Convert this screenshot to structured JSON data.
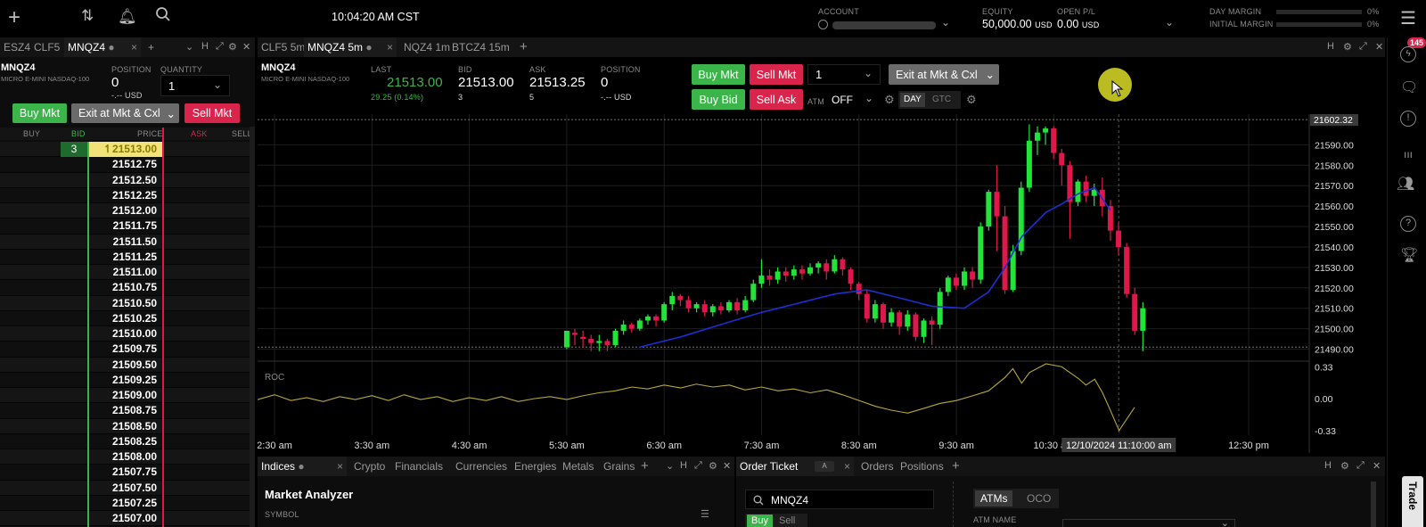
{
  "topbar": {
    "time": "10:04:20 AM CST",
    "account_label": "ACCOUNT",
    "equity_label": "EQUITY",
    "equity_value": "50,000.00",
    "equity_unit": "USD",
    "openpl_label": "OPEN P/L",
    "openpl_value": "0.00",
    "openpl_unit": "USD",
    "day_margin_label": "DAY MARGIN",
    "day_margin_value": "0%",
    "initial_margin_label": "INITIAL MARGIN",
    "initial_margin_value": "0%"
  },
  "left_tabs": [
    "ESZ4",
    "CLF5",
    "MNQZ4"
  ],
  "dom": {
    "symbol": "MNQZ4",
    "description": "MICRO E-MINI NASDAQ-100",
    "position_label": "POSITION",
    "position_value": "0",
    "position_usd": "-.-- USD",
    "quantity_label": "QUANTITY",
    "quantity_value": "1",
    "buy_mkt": "Buy Mkt",
    "exit_mkt": "Exit at Mkt & Cxl",
    "sell_mkt": "Sell Mkt",
    "col_buy": "BUY",
    "col_bid": "BID",
    "col_price": "PRICE",
    "col_ask": "ASK",
    "col_sell": "SELL",
    "bid_size": "3",
    "prices": [
      "21513.00",
      "21512.75",
      "21512.50",
      "21512.25",
      "21512.00",
      "21511.75",
      "21511.50",
      "21511.25",
      "21511.00",
      "21510.75",
      "21510.50",
      "21510.25",
      "21510.00",
      "21509.75",
      "21509.50",
      "21509.25",
      "21509.00",
      "21508.75",
      "21508.50",
      "21508.25",
      "21508.00",
      "21507.75",
      "21507.50",
      "21507.25",
      "21507.00"
    ]
  },
  "chart_tabs": [
    {
      "label": "CLF5",
      "tf": "5m"
    },
    {
      "label": "MNQZ4",
      "tf": "5m"
    },
    {
      "label": "NQZ4",
      "tf": "1m"
    },
    {
      "label": "BTCZ4",
      "tf": "15m"
    }
  ],
  "quote": {
    "symbol": "MNQZ4",
    "description": "MICRO E-MINI NASDAQ-100",
    "last_label": "LAST",
    "last_value": "21513.00",
    "change": "29.25 (0.14%)",
    "bid_label": "BID",
    "bid_value": "21513.00",
    "bid_size": "3",
    "ask_label": "ASK",
    "ask_value": "21513.25",
    "ask_size": "5",
    "position_label": "POSITION",
    "position_value": "0",
    "position_usd": "-.-- USD"
  },
  "order_bar": {
    "buy_mkt": "Buy Mkt",
    "sell_mkt": "Sell Mkt",
    "buy_bid": "Buy Bid",
    "sell_ask": "Sell Ask",
    "quantity": "1",
    "exit": "Exit at Mkt & Cxl",
    "atm_label": "ATM",
    "atm_value": "OFF",
    "day": "DAY",
    "gtc": "GTC"
  },
  "chart_data": {
    "type": "candlestick",
    "symbol": "MNQZ4",
    "interval": "5m",
    "x_ticks": [
      "2:30 am",
      "3:30 am",
      "4:30 am",
      "5:30 am",
      "6:30 am",
      "7:30 am",
      "8:30 am",
      "9:30 am",
      "10:30 am",
      "12:30 pm"
    ],
    "y_ticks": [
      "21590.00",
      "21580.00",
      "21570.00",
      "21560.00",
      "21550.00",
      "21540.00",
      "21530.00",
      "21520.00",
      "21510.00",
      "21500.00",
      "21490.00"
    ],
    "ylim": [
      21485,
      21605
    ],
    "high_label": "21602.32",
    "crosshair_time": "12/10/2024 11:10:00 am",
    "candle_start_hours": 5.5,
    "candle_interval_hours": 0.0833,
    "candles": [
      [
        21491,
        21499,
        21490,
        21498
      ],
      [
        21498,
        21497,
        21492,
        21500
      ],
      [
        21496,
        21495,
        21491,
        21499
      ],
      [
        21495,
        21493,
        21489,
        21497
      ],
      [
        21493,
        21494,
        21489,
        21497
      ],
      [
        21494,
        21492,
        21489,
        21495
      ],
      [
        21492,
        21499,
        21491,
        21500
      ],
      [
        21499,
        21502,
        21497,
        21504
      ],
      [
        21502,
        21500,
        21498,
        21503
      ],
      [
        21500,
        21504,
        21499,
        21505
      ],
      [
        21504,
        21506,
        21502,
        21507
      ],
      [
        21506,
        21504,
        21501,
        21507
      ],
      [
        21504,
        21512,
        21503,
        21513
      ],
      [
        21512,
        21516,
        21509,
        21518
      ],
      [
        21516,
        21514,
        21511,
        21517
      ],
      [
        21514,
        21510,
        21508,
        21516
      ],
      [
        21510,
        21512,
        21508,
        21513
      ],
      [
        21512,
        21508,
        21506,
        21514
      ],
      [
        21508,
        21511,
        21506,
        21512
      ],
      [
        21511,
        21509,
        21507,
        21513
      ],
      [
        21509,
        21513,
        21508,
        21514
      ],
      [
        21513,
        21509,
        21507,
        21515
      ],
      [
        21509,
        21514,
        21508,
        21516
      ],
      [
        21514,
        21522,
        21513,
        21524
      ],
      [
        21522,
        21526,
        21520,
        21534
      ],
      [
        21526,
        21524,
        21521,
        21529
      ],
      [
        21524,
        21528,
        21522,
        21530
      ],
      [
        21528,
        21526,
        21523,
        21530
      ],
      [
        21526,
        21529,
        21524,
        21531
      ],
      [
        21529,
        21527,
        21524,
        21531
      ],
      [
        21527,
        21530,
        21526,
        21532
      ],
      [
        21530,
        21532,
        21527,
        21533
      ],
      [
        21532,
        21528,
        21524,
        21534
      ],
      [
        21528,
        21534,
        21527,
        21536
      ],
      [
        21534,
        21529,
        21526,
        21535
      ],
      [
        21529,
        21522,
        21519,
        21530
      ],
      [
        21522,
        21517,
        21514,
        21523
      ],
      [
        21517,
        21505,
        21503,
        21519
      ],
      [
        21505,
        21512,
        21503,
        21514
      ],
      [
        21512,
        21503,
        21500,
        21513
      ],
      [
        21503,
        21508,
        21501,
        21510
      ],
      [
        21508,
        21501,
        21497,
        21509
      ],
      [
        21501,
        21507,
        21499,
        21509
      ],
      [
        21507,
        21496,
        21494,
        21508
      ],
      [
        21496,
        21504,
        21493,
        21505
      ],
      [
        21504,
        21502,
        21492,
        21506
      ],
      [
        21502,
        21518,
        21500,
        21520
      ],
      [
        21518,
        21525,
        21516,
        21526
      ],
      [
        21525,
        21521,
        21519,
        21527
      ],
      [
        21521,
        21528,
        21519,
        21530
      ],
      [
        21528,
        21524,
        21520,
        21530
      ],
      [
        21524,
        21550,
        21522,
        21552
      ],
      [
        21550,
        21567,
        21548,
        21568
      ],
      [
        21567,
        21555,
        21538,
        21580
      ],
      [
        21555,
        21519,
        21517,
        21560
      ],
      [
        21519,
        21538,
        21518,
        21541
      ],
      [
        21538,
        21569,
        21536,
        21572
      ],
      [
        21569,
        21592,
        21567,
        21600
      ],
      [
        21592,
        21596,
        21585,
        21599
      ],
      [
        21596,
        21598,
        21590,
        21599
      ],
      [
        21598,
        21586,
        21583,
        21599
      ],
      [
        21586,
        21580,
        21570,
        21588
      ],
      [
        21580,
        21562,
        21544,
        21582
      ],
      [
        21562,
        21572,
        21560,
        21573
      ],
      [
        21572,
        21565,
        21562,
        21575
      ],
      [
        21565,
        21568,
        21560,
        21571
      ],
      [
        21568,
        21560,
        21555,
        21574
      ],
      [
        21560,
        21548,
        21543,
        21563
      ],
      [
        21548,
        21540,
        21536,
        21552
      ],
      [
        21540,
        21517,
        21515,
        21542
      ],
      [
        21517,
        21499,
        21497,
        21520
      ],
      [
        21499,
        21510,
        21489,
        21513
      ]
    ],
    "ma_series": [
      [
        6.25,
        21491
      ],
      [
        6.67,
        21496
      ],
      [
        7.08,
        21502
      ],
      [
        7.5,
        21508
      ],
      [
        7.92,
        21513
      ],
      [
        8.25,
        21517
      ],
      [
        8.58,
        21519
      ],
      [
        8.92,
        21515
      ],
      [
        9.25,
        21511
      ],
      [
        9.58,
        21510
      ],
      [
        9.83,
        21518
      ],
      [
        10.0,
        21530
      ],
      [
        10.17,
        21545
      ],
      [
        10.42,
        21557
      ],
      [
        10.58,
        21561
      ],
      [
        10.75,
        21566
      ],
      [
        10.92,
        21569
      ],
      [
        11.08,
        21558
      ]
    ],
    "indicator": {
      "name": "ROC",
      "y_ticks": [
        "0.33",
        "0.00",
        "-0.33"
      ],
      "ylim": [
        -0.36,
        0.36
      ],
      "values": [
        [
          2.0,
          0.0
        ],
        [
          2.17,
          0.03
        ],
        [
          2.33,
          -0.01
        ],
        [
          2.5,
          0.04
        ],
        [
          2.67,
          -0.02
        ],
        [
          2.83,
          0.01
        ],
        [
          3.0,
          -0.03
        ],
        [
          3.17,
          0.02
        ],
        [
          3.33,
          -0.01
        ],
        [
          3.5,
          0.03
        ],
        [
          3.67,
          -0.02
        ],
        [
          3.83,
          0.04
        ],
        [
          4.0,
          -0.01
        ],
        [
          4.17,
          0.02
        ],
        [
          4.33,
          -0.03
        ],
        [
          4.5,
          0.01
        ],
        [
          4.67,
          -0.02
        ],
        [
          4.83,
          0.02
        ],
        [
          5.0,
          -0.03
        ],
        [
          5.17,
          0.0
        ],
        [
          5.33,
          0.02
        ],
        [
          5.5,
          -0.01
        ],
        [
          5.67,
          0.03
        ],
        [
          5.83,
          0.06
        ],
        [
          6.0,
          0.08
        ],
        [
          6.17,
          0.12
        ],
        [
          6.33,
          0.1
        ],
        [
          6.5,
          0.14
        ],
        [
          6.67,
          0.11
        ],
        [
          6.83,
          0.15
        ],
        [
          7.0,
          0.12
        ],
        [
          7.17,
          0.14
        ],
        [
          7.33,
          0.09
        ],
        [
          7.5,
          0.12
        ],
        [
          7.67,
          0.08
        ],
        [
          7.83,
          0.1
        ],
        [
          8.0,
          0.06
        ],
        [
          8.17,
          0.09
        ],
        [
          8.33,
          0.04
        ],
        [
          8.5,
          -0.02
        ],
        [
          8.67,
          -0.08
        ],
        [
          8.83,
          -0.12
        ],
        [
          9.0,
          -0.15
        ],
        [
          9.17,
          -0.1
        ],
        [
          9.33,
          -0.05
        ],
        [
          9.5,
          -0.02
        ],
        [
          9.67,
          0.03
        ],
        [
          9.83,
          0.08
        ],
        [
          10.0,
          0.22
        ],
        [
          10.08,
          0.31
        ],
        [
          10.17,
          0.16
        ],
        [
          10.25,
          0.27
        ],
        [
          10.42,
          0.36
        ],
        [
          10.58,
          0.33
        ],
        [
          10.75,
          0.21
        ],
        [
          10.83,
          0.14
        ],
        [
          10.92,
          0.2
        ],
        [
          11.0,
          0.06
        ],
        [
          11.08,
          -0.12
        ],
        [
          11.17,
          -0.33
        ],
        [
          11.33,
          -0.09
        ]
      ]
    }
  },
  "bottom_left": {
    "tabs": [
      "Indices",
      "Crypto",
      "Financials",
      "Currencies",
      "Energies",
      "Metals",
      "Grains"
    ],
    "title": "Market Analyzer",
    "symbol_col": "SYMBOL"
  },
  "bottom_right": {
    "tabs": [
      "Order Ticket",
      "Orders",
      "Positions"
    ],
    "search_value": "MNQZ4",
    "buy": "Buy",
    "sell": "Sell",
    "atms": "ATMs",
    "oco": "OCO",
    "atm_name_label": "ATM NAME"
  },
  "sidebar": {
    "badge": "145",
    "trade_label": "Trade"
  },
  "colors": {
    "up": "#22e33a",
    "down": "#e0174a",
    "ma": "#1f2fcf",
    "roc": "#b8a83a",
    "bid_green": "#1f6b2d",
    "price_highlight": "#f1e37a"
  }
}
